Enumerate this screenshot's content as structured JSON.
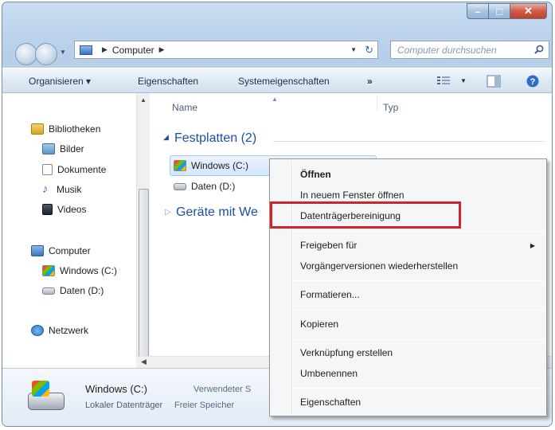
{
  "window": {
    "caption": {
      "minimize": "–",
      "maximize": "□",
      "close": "✕"
    }
  },
  "address": {
    "path": "Computer",
    "search_placeholder": "Computer durchsuchen"
  },
  "toolbar": {
    "organize": "Organisieren ▾",
    "properties": "Eigenschaften",
    "system_properties": "Systemeigenschaften",
    "more": "»"
  },
  "nav": {
    "libraries": "Bibliotheken",
    "pictures": "Bilder",
    "documents": "Dokumente",
    "music": "Musik",
    "videos": "Videos",
    "computer": "Computer",
    "drive_c": "Windows (C:)",
    "drive_d": "Daten (D:)",
    "network": "Netzwerk"
  },
  "files": {
    "col_name": "Name",
    "col_type": "Typ",
    "group_hard_disks": "Festplatten (2)",
    "group_devices": "Geräte mit We",
    "drive_c": "Windows (C:)",
    "drive_d": "Daten (D:)"
  },
  "details": {
    "name": "Windows (C:)",
    "type": "Lokaler Datenträger",
    "used_label": "Verwendeter S",
    "free_label": "Freier Speicher"
  },
  "context_menu": {
    "open": "Öffnen",
    "open_new_window": "In neuem Fenster öffnen",
    "disk_cleanup": "Datenträgerbereinigung",
    "share_with": "Freigeben für",
    "restore_previous": "Vorgängerversionen wiederherstellen",
    "format": "Formatieren...",
    "copy": "Kopieren",
    "create_shortcut": "Verknüpfung erstellen",
    "rename": "Umbenennen",
    "properties": "Eigenschaften"
  },
  "colors": {
    "highlight": "#d2232a",
    "group_title": "#1e4fa3"
  }
}
